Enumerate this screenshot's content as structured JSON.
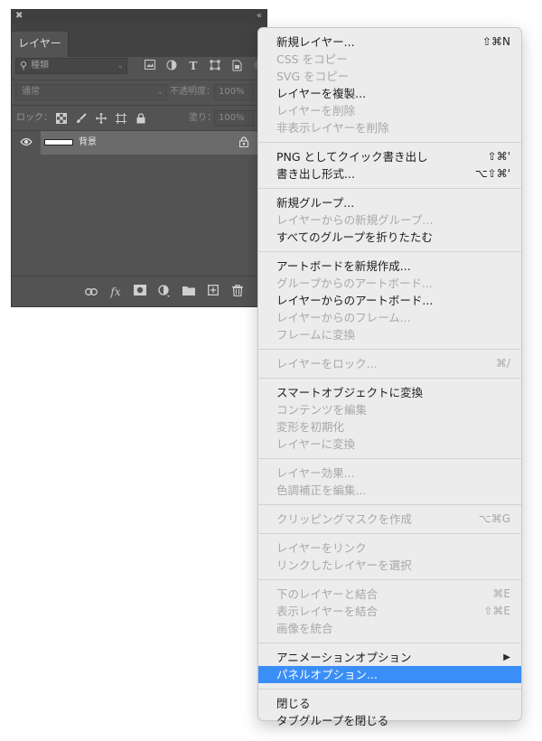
{
  "layers_panel": {
    "tab_label": "レイヤー",
    "filter": {
      "label": "種類"
    },
    "blend_mode": "通常",
    "opacity_label": "不透明度：",
    "opacity_value": "100%",
    "lock_label": "ロック：",
    "fill_label": "塗り：",
    "fill_value": "100%",
    "layer": {
      "name": "背景"
    }
  },
  "menu": {
    "groups": [
      [
        {
          "label": "新規レイヤー...",
          "shortcut": "⇧⌘N",
          "enabled": true
        },
        {
          "label": "CSS をコピー",
          "enabled": false
        },
        {
          "label": "SVG をコピー",
          "enabled": false
        },
        {
          "label": "レイヤーを複製...",
          "enabled": true
        },
        {
          "label": "レイヤーを削除",
          "enabled": false
        },
        {
          "label": "非表示レイヤーを削除",
          "enabled": false
        }
      ],
      [
        {
          "label": "PNG としてクイック書き出し",
          "shortcut": "⇧⌘'",
          "enabled": true
        },
        {
          "label": "書き出し形式...",
          "shortcut": "⌥⇧⌘'",
          "enabled": true
        }
      ],
      [
        {
          "label": "新規グループ...",
          "enabled": true
        },
        {
          "label": "レイヤーからの新規グループ...",
          "enabled": false
        },
        {
          "label": "すべてのグループを折りたたむ",
          "enabled": true
        }
      ],
      [
        {
          "label": "アートボードを新規作成...",
          "enabled": true
        },
        {
          "label": "グループからのアートボード...",
          "enabled": false
        },
        {
          "label": "レイヤーからのアートボード...",
          "enabled": true
        },
        {
          "label": "レイヤーからのフレーム...",
          "enabled": false
        },
        {
          "label": "フレームに変換",
          "enabled": false
        }
      ],
      [
        {
          "label": "レイヤーをロック...",
          "shortcut": "⌘/",
          "enabled": false
        }
      ],
      [
        {
          "label": "スマートオブジェクトに変換",
          "enabled": true
        },
        {
          "label": "コンテンツを編集",
          "enabled": false
        },
        {
          "label": "変形を初期化",
          "enabled": false
        },
        {
          "label": "レイヤーに変換",
          "enabled": false
        }
      ],
      [
        {
          "label": "レイヤー効果...",
          "enabled": false
        },
        {
          "label": "色調補正を編集...",
          "enabled": false
        }
      ],
      [
        {
          "label": "クリッピングマスクを作成",
          "shortcut": "⌥⌘G",
          "enabled": false
        }
      ],
      [
        {
          "label": "レイヤーをリンク",
          "enabled": false
        },
        {
          "label": "リンクしたレイヤーを選択",
          "enabled": false
        }
      ],
      [
        {
          "label": "下のレイヤーと結合",
          "shortcut": "⌘E",
          "enabled": false
        },
        {
          "label": "表示レイヤーを結合",
          "shortcut": "⇧⌘E",
          "enabled": false
        },
        {
          "label": "画像を統合",
          "enabled": false
        }
      ],
      [
        {
          "label": "アニメーションオプション",
          "submenu": true,
          "enabled": true
        },
        {
          "label": "パネルオプション...",
          "enabled": true,
          "highlighted": true
        }
      ],
      [
        {
          "label": "閉じる",
          "enabled": true
        },
        {
          "label": "タブグループを閉じる",
          "enabled": true
        }
      ]
    ]
  }
}
